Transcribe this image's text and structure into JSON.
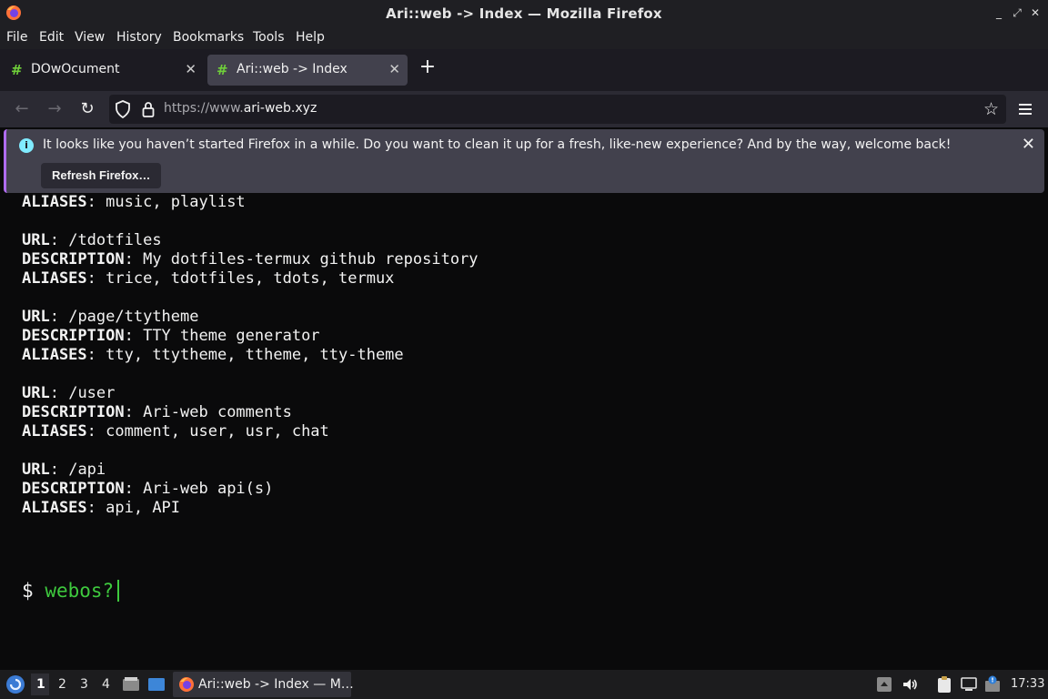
{
  "window": {
    "title": "Ari::web -> Index — Mozilla Firefox"
  },
  "menu": [
    "File",
    "Edit",
    "View",
    "History",
    "Bookmarks",
    "Tools",
    "Help"
  ],
  "tabs": [
    {
      "label": "DOwOcument",
      "active": false,
      "icon": "hash-favicon"
    },
    {
      "label": "Ari::web -> Index",
      "active": true,
      "icon": "hash-favicon"
    }
  ],
  "nav": {
    "url_prefix": "https://www.",
    "url_host": "ari-web.xyz"
  },
  "notification": {
    "message": "It looks like you haven’t started Firefox in a while. Do you want to clean it up for a fresh, like-new experience? And by the way, welcome back!",
    "button_label": "Refresh Firefox…"
  },
  "content": {
    "lines": [
      {
        "key": "ALIASES",
        "value": "music, playlist"
      },
      {
        "key": "URL",
        "value": "/tdotfiles"
      },
      {
        "key": "DESCRIPTION",
        "value": "My dotfiles-termux github repository"
      },
      {
        "key": "ALIASES",
        "value": "trice, tdotfiles, tdots, termux"
      },
      {
        "key": "URL",
        "value": "/page/ttytheme"
      },
      {
        "key": "DESCRIPTION",
        "value": "TTY theme generator"
      },
      {
        "key": "ALIASES",
        "value": "tty, ttytheme, ttheme, tty-theme"
      },
      {
        "key": "URL",
        "value": "/user"
      },
      {
        "key": "DESCRIPTION",
        "value": "Ari-web comments"
      },
      {
        "key": "ALIASES",
        "value": "comment, user, usr, chat"
      },
      {
        "key": "URL",
        "value": "/api"
      },
      {
        "key": "DESCRIPTION",
        "value": "Ari-web api(s)"
      },
      {
        "key": "ALIASES",
        "value": "api, API"
      }
    ],
    "prompt_symbol": "$",
    "prompt_input": "webos?"
  },
  "taskbar": {
    "workspaces": [
      "1",
      "2",
      "3",
      "4"
    ],
    "active_workspace": "1",
    "task_label": "Ari::web -> Index — M…",
    "clock": "17:33"
  },
  "colors": {
    "prompt_green": "#3ec93e",
    "notification_accent": "#b06cf0",
    "favicon_green": "#6fcf3a"
  }
}
